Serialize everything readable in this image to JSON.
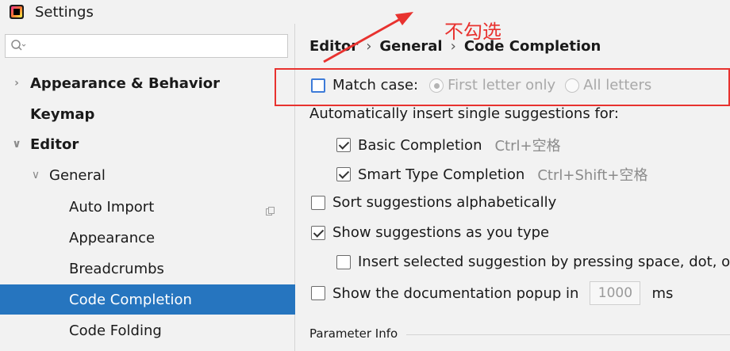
{
  "window": {
    "title": "Settings"
  },
  "search": {
    "placeholder": "",
    "value": ""
  },
  "sidebar": {
    "items": [
      {
        "label": "Appearance & Behavior",
        "chevron": "›",
        "bold": true
      },
      {
        "label": "Keymap",
        "bold": true
      },
      {
        "label": "Editor",
        "chevron": "∨",
        "bold": true
      },
      {
        "label": "General",
        "chevron": "∨"
      },
      {
        "label": "Auto Import"
      },
      {
        "label": "Appearance"
      },
      {
        "label": "Breadcrumbs"
      },
      {
        "label": "Code Completion",
        "selected": true
      },
      {
        "label": "Code Folding"
      }
    ]
  },
  "breadcrumb": {
    "part1": "Editor",
    "part2": "General",
    "part3": "Code Completion",
    "separator": "›"
  },
  "options": {
    "match_case": {
      "label": "Match case:",
      "checked": false
    },
    "first_letter_only": {
      "label": "First letter only",
      "selected": true,
      "enabled": false
    },
    "all_letters": {
      "label": "All letters",
      "selected": false,
      "enabled": false
    },
    "auto_insert_label": "Automatically insert single suggestions for:",
    "basic_completion": {
      "label": "Basic Completion",
      "shortcut": "Ctrl+空格",
      "checked": true
    },
    "smart_type_completion": {
      "label": "Smart Type Completion",
      "shortcut": "Ctrl+Shift+空格",
      "checked": true
    },
    "sort_alphabetically": {
      "label": "Sort suggestions alphabetically",
      "checked": false
    },
    "show_as_you_type": {
      "label": "Show suggestions as you type",
      "checked": true
    },
    "insert_selected": {
      "label": "Insert selected suggestion by pressing space, dot, o",
      "checked": false
    },
    "doc_popup": {
      "label_before": "Show the documentation popup in",
      "value": "1000",
      "unit": "ms",
      "checked": false
    }
  },
  "section": {
    "parameter_info": "Parameter Info"
  },
  "annotation": {
    "text": "不勾选",
    "color": "#e8322f"
  },
  "colors": {
    "selection": "#2675bf",
    "annotation": "#e8322f"
  }
}
